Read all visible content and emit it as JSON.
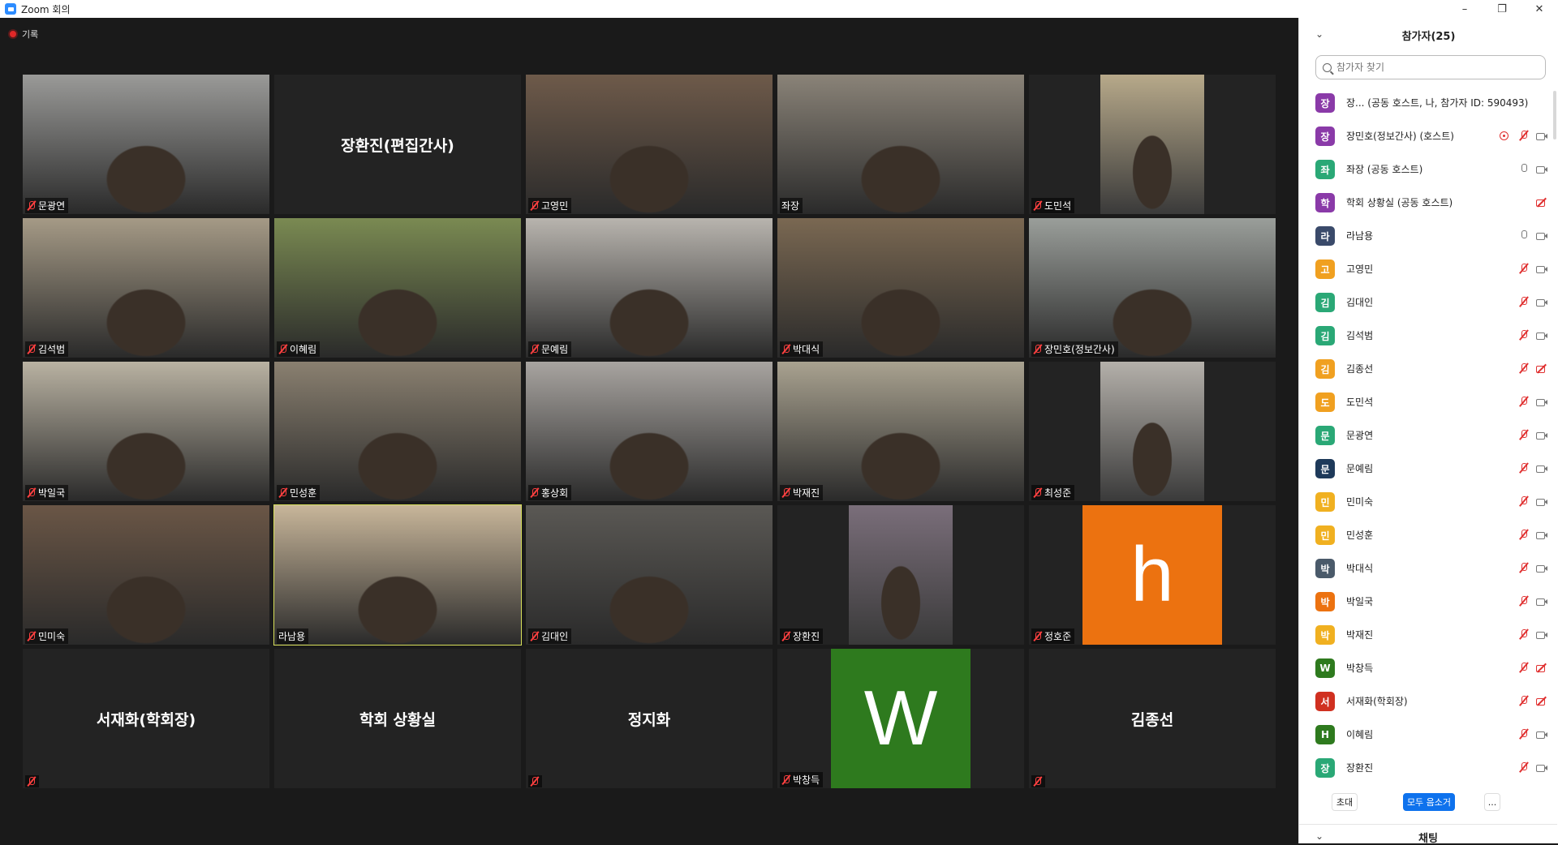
{
  "window": {
    "title": "Zoom 회의",
    "min": "–",
    "restore": "❐",
    "close": "✕"
  },
  "recording": {
    "label": "기록"
  },
  "tiles": [
    {
      "name": "문광연",
      "type": "video",
      "bg": "#9a9a98",
      "muted": true
    },
    {
      "name": "장환진(편집간사)",
      "type": "name",
      "muted": false
    },
    {
      "name": "고영민",
      "type": "video",
      "bg": "#6e5a4a",
      "muted": true
    },
    {
      "name": "좌장",
      "type": "video",
      "bg": "#8a8378",
      "muted": false
    },
    {
      "name": "도민석",
      "type": "video-narrow",
      "bg": "#b7a98a",
      "muted": true
    },
    {
      "name": "김석범",
      "type": "video",
      "bg": "#a59a86",
      "muted": true
    },
    {
      "name": "이혜림",
      "type": "video",
      "bg": "#7a8a52",
      "muted": true
    },
    {
      "name": "문예림",
      "type": "video",
      "bg": "#b8b4ae",
      "muted": true
    },
    {
      "name": "박대식",
      "type": "video",
      "bg": "#7a6852",
      "muted": true
    },
    {
      "name": "장민호(정보간사)",
      "type": "video",
      "bg": "#9a9e9a",
      "muted": true
    },
    {
      "name": "박일국",
      "type": "video",
      "bg": "#b9b2a2",
      "muted": true
    },
    {
      "name": "민성훈",
      "type": "video",
      "bg": "#8a8070",
      "muted": true
    },
    {
      "name": "홍상회",
      "type": "video",
      "bg": "#a8a4a0",
      "muted": true
    },
    {
      "name": "박재진",
      "type": "video",
      "bg": "#a9a290",
      "muted": true
    },
    {
      "name": "최성준",
      "type": "video-narrow",
      "bg": "#b4b0aa",
      "muted": true
    },
    {
      "name": "민미숙",
      "type": "video",
      "bg": "#6a5646",
      "muted": true
    },
    {
      "name": "라남용",
      "type": "video",
      "bg": "#c8b69a",
      "muted": false,
      "active": true
    },
    {
      "name": "김대인",
      "type": "video",
      "bg": "#5a5854",
      "muted": true
    },
    {
      "name": "장환진",
      "type": "video-narrow",
      "bg": "#7a6e7a",
      "muted": true
    },
    {
      "name": "정호준",
      "type": "avatar",
      "letter": "h",
      "avatar_color": "#ec7210",
      "muted": true
    },
    {
      "name": "서재화(학회장)",
      "type": "name",
      "muted": true,
      "hide_label": true
    },
    {
      "name": "학회 상황실",
      "type": "name",
      "muted": false
    },
    {
      "name": "정지화",
      "type": "name",
      "muted": true,
      "hide_label": true
    },
    {
      "name": "박창득",
      "type": "avatar",
      "letter": "W",
      "avatar_color": "#2e7a1e",
      "muted": true
    },
    {
      "name": "김종선",
      "type": "name",
      "muted": true,
      "hide_label": true
    }
  ],
  "panel": {
    "title": "참가자(25)",
    "search_placeholder": "참가자 찾기",
    "participants": [
      {
        "initial": "장",
        "color": "#8a3aa8",
        "name": "장...   (공동 호스트, 나, 참가자 ID: 590493)",
        "mic": "none",
        "cam": "none"
      },
      {
        "initial": "장",
        "color": "#8a3aa8",
        "name": "장민호(정보간사) (호스트)",
        "mic": "off",
        "cam": "on",
        "rec": true
      },
      {
        "initial": "좌",
        "color": "#2aa876",
        "name": "좌장 (공동 호스트)",
        "mic": "on",
        "cam": "on"
      },
      {
        "initial": "학",
        "color": "#8a3aa8",
        "name": "학회 상황실 (공동 호스트)",
        "mic": "none",
        "cam": "off"
      },
      {
        "initial": "라",
        "color": "#3a4a6a",
        "name": "라남용",
        "mic": "on",
        "cam": "on"
      },
      {
        "initial": "고",
        "color": "#f0a020",
        "name": "고영민",
        "mic": "off",
        "cam": "on"
      },
      {
        "initial": "김",
        "color": "#2aa876",
        "name": "김대인",
        "mic": "off",
        "cam": "on"
      },
      {
        "initial": "김",
        "color": "#2aa876",
        "name": "김석범",
        "mic": "off",
        "cam": "on"
      },
      {
        "initial": "김",
        "color": "#f0a020",
        "name": "김종선",
        "mic": "off",
        "cam": "off"
      },
      {
        "initial": "도",
        "color": "#f0a020",
        "name": "도민석",
        "mic": "off",
        "cam": "on"
      },
      {
        "initial": "문",
        "color": "#2aa876",
        "name": "문광연",
        "mic": "off",
        "cam": "on"
      },
      {
        "initial": "문",
        "color": "#1e3a5a",
        "name": "문예림",
        "mic": "off",
        "cam": "on"
      },
      {
        "initial": "민",
        "color": "#f0b020",
        "name": "민미숙",
        "mic": "off",
        "cam": "on"
      },
      {
        "initial": "민",
        "color": "#f0b020",
        "name": "민성훈",
        "mic": "off",
        "cam": "on"
      },
      {
        "initial": "박",
        "color": "#4a5a6a",
        "name": "박대식",
        "mic": "off",
        "cam": "on"
      },
      {
        "initial": "박",
        "color": "#ec7210",
        "name": "박일국",
        "mic": "off",
        "cam": "on"
      },
      {
        "initial": "박",
        "color": "#f0b020",
        "name": "박재진",
        "mic": "off",
        "cam": "on"
      },
      {
        "initial": "W",
        "color": "#2e7a1e",
        "name": "박창득",
        "mic": "off",
        "cam": "off"
      },
      {
        "initial": "서",
        "color": "#d03020",
        "name": "서재화(학회장)",
        "mic": "off",
        "cam": "off"
      },
      {
        "initial": "H",
        "color": "#2e7a1e",
        "name": "이혜림",
        "mic": "off",
        "cam": "on"
      },
      {
        "initial": "장",
        "color": "#2aa876",
        "name": "장환진",
        "mic": "off",
        "cam": "on"
      }
    ],
    "invite_label": "초대",
    "mute_all_label": "모두 음소거",
    "more_label": "...",
    "chat_title": "채팅"
  }
}
